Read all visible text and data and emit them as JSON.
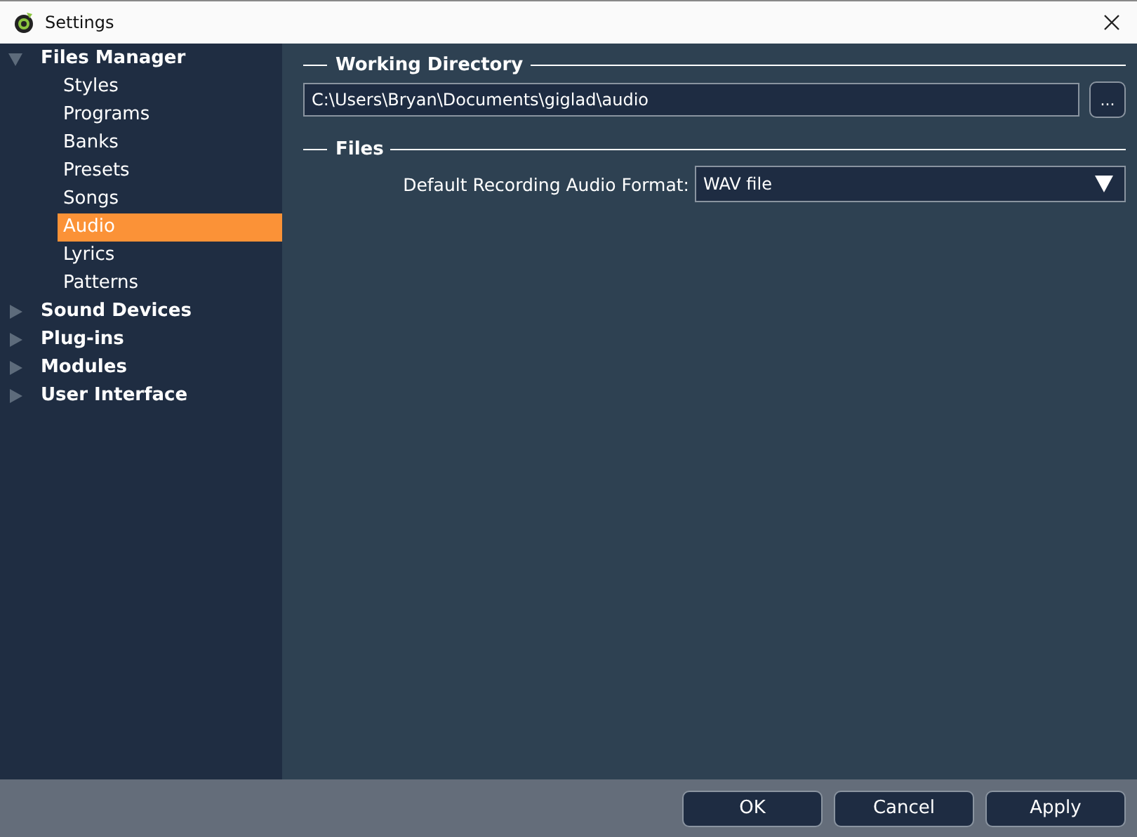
{
  "window": {
    "title": "Settings"
  },
  "sidebar": {
    "items": [
      {
        "label": "Files Manager",
        "expanded": true,
        "selected": false,
        "children": [
          {
            "label": "Styles",
            "selected": false
          },
          {
            "label": "Programs",
            "selected": false
          },
          {
            "label": "Banks",
            "selected": false
          },
          {
            "label": "Presets",
            "selected": false
          },
          {
            "label": "Songs",
            "selected": false
          },
          {
            "label": "Audio",
            "selected": true
          },
          {
            "label": "Lyrics",
            "selected": false
          },
          {
            "label": "Patterns",
            "selected": false
          }
        ]
      },
      {
        "label": "Sound Devices",
        "expanded": false,
        "selected": false
      },
      {
        "label": "Plug-ins",
        "expanded": false,
        "selected": false
      },
      {
        "label": "Modules",
        "expanded": false,
        "selected": false
      },
      {
        "label": "User Interface",
        "expanded": false,
        "selected": false
      }
    ]
  },
  "sections": [
    {
      "title": "Working Directory",
      "kind": "path",
      "value": "C:\\Users\\Bryan\\Documents\\giglad\\audio",
      "browse": "..."
    },
    {
      "title": "Files",
      "kind": "select",
      "label": "Default Recording Audio Format:",
      "value": "WAV file"
    }
  ],
  "buttons": [
    "OK",
    "Cancel",
    "Apply"
  ]
}
